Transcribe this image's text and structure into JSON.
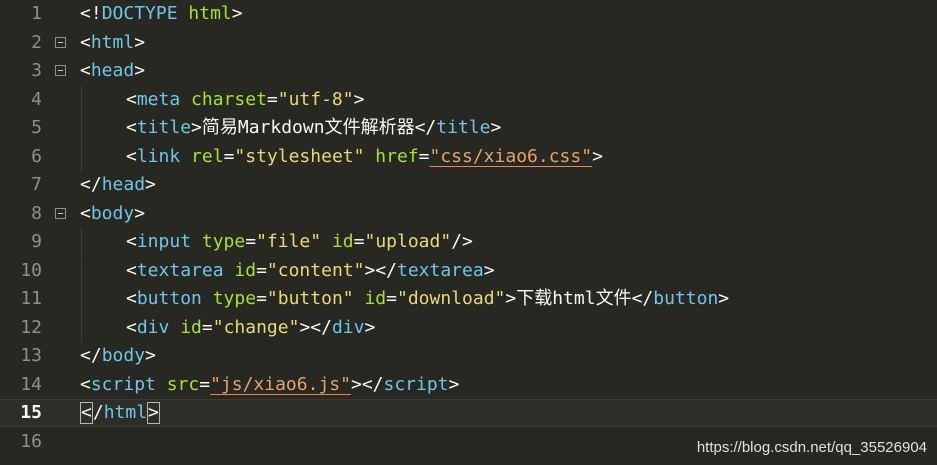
{
  "lines": [
    {
      "num": "1",
      "segs": [
        [
          "<!",
          "p"
        ],
        [
          "DOCTYPE",
          "t"
        ],
        [
          " ",
          "tx"
        ],
        [
          "html",
          "a"
        ],
        [
          ">",
          "p"
        ]
      ]
    },
    {
      "num": "2",
      "fold": true,
      "segs": [
        [
          "<",
          "p"
        ],
        [
          "html",
          "t"
        ],
        [
          ">",
          "p"
        ]
      ]
    },
    {
      "num": "3",
      "fold": true,
      "segs": [
        [
          "<",
          "p"
        ],
        [
          "head",
          "t"
        ],
        [
          ">",
          "p"
        ]
      ]
    },
    {
      "num": "4",
      "indent": true,
      "segs": [
        [
          "<",
          "p"
        ],
        [
          "meta",
          "t"
        ],
        [
          " ",
          "tx"
        ],
        [
          "charset",
          "a"
        ],
        [
          "=",
          "p"
        ],
        [
          "\"utf-8\"",
          "s"
        ],
        [
          ">",
          "p"
        ]
      ]
    },
    {
      "num": "5",
      "indent": true,
      "segs": [
        [
          "<",
          "p"
        ],
        [
          "title",
          "t"
        ],
        [
          ">",
          "p"
        ],
        [
          "简易Markdown文件解析器",
          "tx"
        ],
        [
          "</",
          "p"
        ],
        [
          "title",
          "t"
        ],
        [
          ">",
          "p"
        ]
      ]
    },
    {
      "num": "6",
      "indent": true,
      "segs": [
        [
          "<",
          "p"
        ],
        [
          "link",
          "t"
        ],
        [
          " ",
          "tx"
        ],
        [
          "rel",
          "a"
        ],
        [
          "=",
          "p"
        ],
        [
          "\"stylesheet\"",
          "s"
        ],
        [
          " ",
          "tx"
        ],
        [
          "href",
          "a"
        ],
        [
          "=",
          "p"
        ],
        [
          "\"css/xiao6.css\"",
          "s2u"
        ],
        [
          ">",
          "p"
        ]
      ]
    },
    {
      "num": "7",
      "segs": [
        [
          "</",
          "p"
        ],
        [
          "head",
          "t"
        ],
        [
          ">",
          "p"
        ]
      ]
    },
    {
      "num": "8",
      "fold": true,
      "segs": [
        [
          "<",
          "p"
        ],
        [
          "body",
          "t"
        ],
        [
          ">",
          "p"
        ]
      ]
    },
    {
      "num": "9",
      "indent": true,
      "segs": [
        [
          "<",
          "p"
        ],
        [
          "input",
          "t"
        ],
        [
          " ",
          "tx"
        ],
        [
          "type",
          "a"
        ],
        [
          "=",
          "p"
        ],
        [
          "\"file\"",
          "s"
        ],
        [
          " ",
          "tx"
        ],
        [
          "id",
          "a"
        ],
        [
          "=",
          "p"
        ],
        [
          "\"upload\"",
          "s"
        ],
        [
          "/>",
          "p"
        ]
      ]
    },
    {
      "num": "10",
      "indent": true,
      "segs": [
        [
          "<",
          "p"
        ],
        [
          "textarea",
          "t"
        ],
        [
          " ",
          "tx"
        ],
        [
          "id",
          "a"
        ],
        [
          "=",
          "p"
        ],
        [
          "\"content\"",
          "s"
        ],
        [
          ">",
          "p"
        ],
        [
          "</",
          "p"
        ],
        [
          "textarea",
          "t"
        ],
        [
          ">",
          "p"
        ]
      ]
    },
    {
      "num": "11",
      "indent": true,
      "segs": [
        [
          "<",
          "p"
        ],
        [
          "button",
          "t"
        ],
        [
          " ",
          "tx"
        ],
        [
          "type",
          "a"
        ],
        [
          "=",
          "p"
        ],
        [
          "\"button\"",
          "s"
        ],
        [
          " ",
          "tx"
        ],
        [
          "id",
          "a"
        ],
        [
          "=",
          "p"
        ],
        [
          "\"download\"",
          "s"
        ],
        [
          ">",
          "p"
        ],
        [
          "下载html文件",
          "tx"
        ],
        [
          "</",
          "p"
        ],
        [
          "button",
          "t"
        ],
        [
          ">",
          "p"
        ]
      ]
    },
    {
      "num": "12",
      "indent": true,
      "segs": [
        [
          "<",
          "p"
        ],
        [
          "div",
          "t"
        ],
        [
          " ",
          "tx"
        ],
        [
          "id",
          "a"
        ],
        [
          "=",
          "p"
        ],
        [
          "\"change\"",
          "s"
        ],
        [
          ">",
          "p"
        ],
        [
          "</",
          "p"
        ],
        [
          "div",
          "t"
        ],
        [
          ">",
          "p"
        ]
      ]
    },
    {
      "num": "13",
      "segs": [
        [
          "</",
          "p"
        ],
        [
          "body",
          "t"
        ],
        [
          ">",
          "p"
        ]
      ]
    },
    {
      "num": "14",
      "segs": [
        [
          "<",
          "p"
        ],
        [
          "script",
          "t"
        ],
        [
          " ",
          "tx"
        ],
        [
          "src",
          "a"
        ],
        [
          "=",
          "p"
        ],
        [
          "\"js/xiao6.js\"",
          "s2u"
        ],
        [
          ">",
          "p"
        ],
        [
          "</",
          "p"
        ],
        [
          "script",
          "t"
        ],
        [
          ">",
          "p"
        ]
      ]
    },
    {
      "num": "15",
      "active": true,
      "segs": [
        [
          "<",
          "cur"
        ],
        [
          "/",
          "p"
        ],
        [
          "html",
          "t"
        ],
        [
          ">",
          "cur"
        ]
      ]
    },
    {
      "num": "16",
      "segs": []
    }
  ],
  "watermark": "https://blog.csdn.net/qq_35526904"
}
